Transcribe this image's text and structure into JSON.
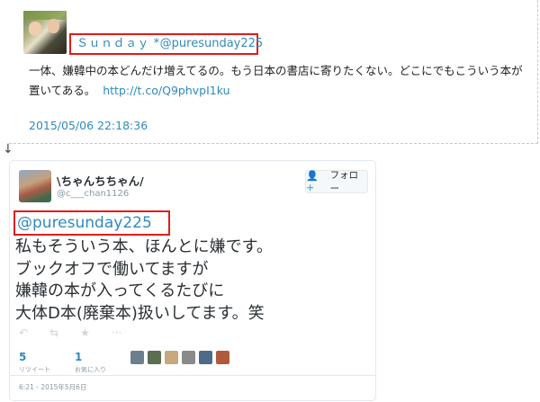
{
  "top_tweet": {
    "display_name": "Ｓｕｎｄａｙ *",
    "handle": "@puresunday225",
    "text": "一体、嫌韓中の本どんだけ増えてるの。もう日本の書店に寄りたくない。どこにでもこういう本が置いてある。",
    "link": "http://t.co/Q9phvpI1ku",
    "datetime": "2015/05/06 22:18:36"
  },
  "arrow": "↓",
  "embedded_tweet": {
    "display_name": "\\ちゃんちちゃん/",
    "screen_name": "@c___chan1126",
    "follow_label": "フォロー",
    "mention": "@puresunday225",
    "body_lines": [
      "私もそういう本、ほんとに嫌です。",
      "ブックオフで働いてますが",
      "嫌韓の本が入ってくるたびに",
      "大体D本(廃棄本)扱いしてます。笑"
    ],
    "retweets": {
      "count": "5",
      "label": "リツイート"
    },
    "favorites": {
      "count": "1",
      "label": "お気に入り"
    },
    "timestamp": "6:21 - 2015年5月6日",
    "action_icons": [
      "reply-icon",
      "retweet-icon",
      "favorite-icon",
      "more-icon"
    ],
    "favoriter_avatar_colors": [
      "#6d7f8f",
      "#5b6e4f",
      "#c9a77f",
      "#8a8a8a",
      "#4e6a8a",
      "#b05a3c"
    ]
  },
  "colors": {
    "link": "#2f8abf",
    "highlight_border": "#e41b17",
    "card_border": "#e1e8ed"
  }
}
